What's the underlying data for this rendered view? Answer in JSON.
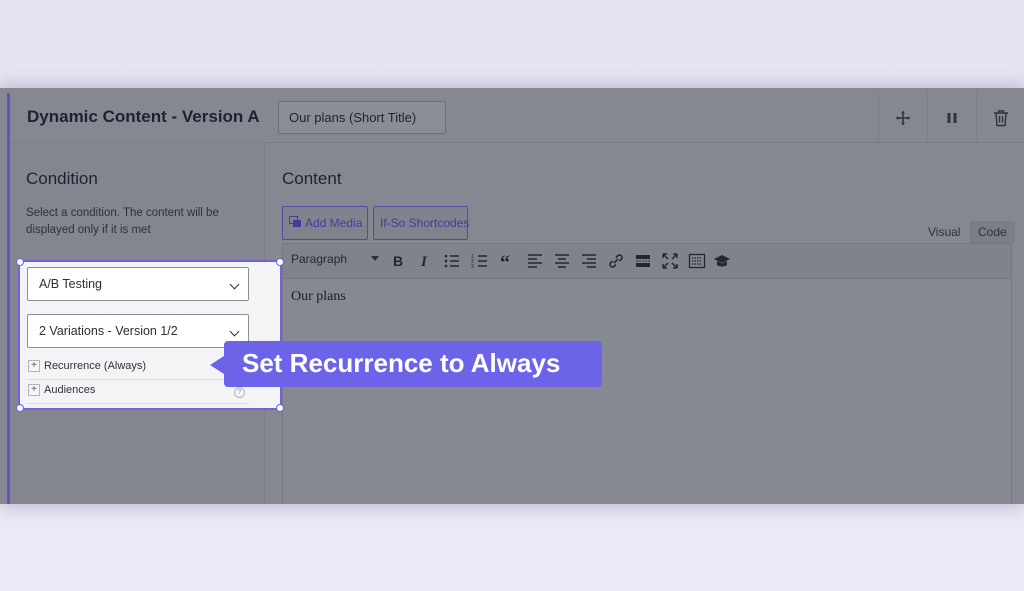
{
  "header": {
    "title": "Dynamic Content - Version A",
    "short_title_value": "Our plans (Short Title)",
    "move_icon": "move-icon",
    "pause_icon": "pause-icon",
    "delete_icon": "trash-icon"
  },
  "condition": {
    "heading": "Condition",
    "description": "Select a condition. The content will be displayed only if it is met",
    "condition_select": "A/B Testing",
    "variation_select": "2 Variations - Version 1/2",
    "accordion": [
      {
        "label": "Recurrence (Always)"
      },
      {
        "label": "Audiences"
      }
    ]
  },
  "content": {
    "heading": "Content",
    "add_media_label": "Add Media",
    "shortcodes_label": "If-So Shortcodes",
    "tab_visual": "Visual",
    "tab_code": "Code",
    "format_select": "Paragraph",
    "editor_text": "Our plans",
    "toolbar_icons": [
      "bold-icon",
      "italic-icon",
      "bullet-list-icon",
      "numbered-list-icon",
      "blockquote-icon",
      "align-left-icon",
      "align-center-icon",
      "align-right-icon",
      "link-icon",
      "read-more-icon",
      "fullscreen-icon",
      "keyboard-icon",
      "graduation-cap-icon"
    ]
  },
  "tooltip": {
    "text": "Set Recurrence to Always"
  },
  "colors": {
    "accent": "#6c63e8",
    "overlay": "#858890"
  }
}
